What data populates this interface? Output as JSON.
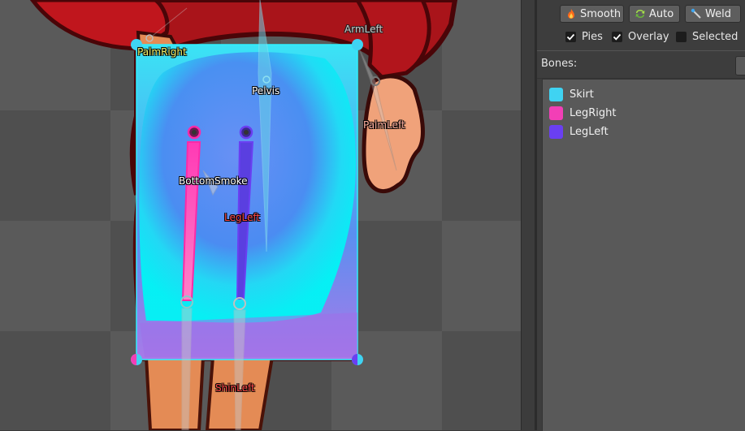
{
  "viewport": {
    "bone_labels": {
      "palm_right": "PalmRight",
      "arm_left": "ArmLeft",
      "pelvis": "Pelvis",
      "palm_left": "PalmLeft",
      "bottom_smoke": "BottomSmoke",
      "leg_left": "LegLeft",
      "shin_left": "ShinLeft"
    }
  },
  "toolbar": {
    "smooth_label": "Smooth",
    "auto_label": "Auto",
    "weld_label": "Weld"
  },
  "options": {
    "pies_label": "Pies",
    "pies_checked": true,
    "overlay_label": "Overlay",
    "overlay_checked": true,
    "selected_label": "Selected",
    "selected_checked": false
  },
  "bones_panel": {
    "title": "Bones:",
    "items": [
      {
        "label": "Skirt",
        "color": "#3fd3f2"
      },
      {
        "label": "LegRight",
        "color": "#f23fb6"
      },
      {
        "label": "LegLeft",
        "color": "#6a3ff2"
      }
    ]
  }
}
